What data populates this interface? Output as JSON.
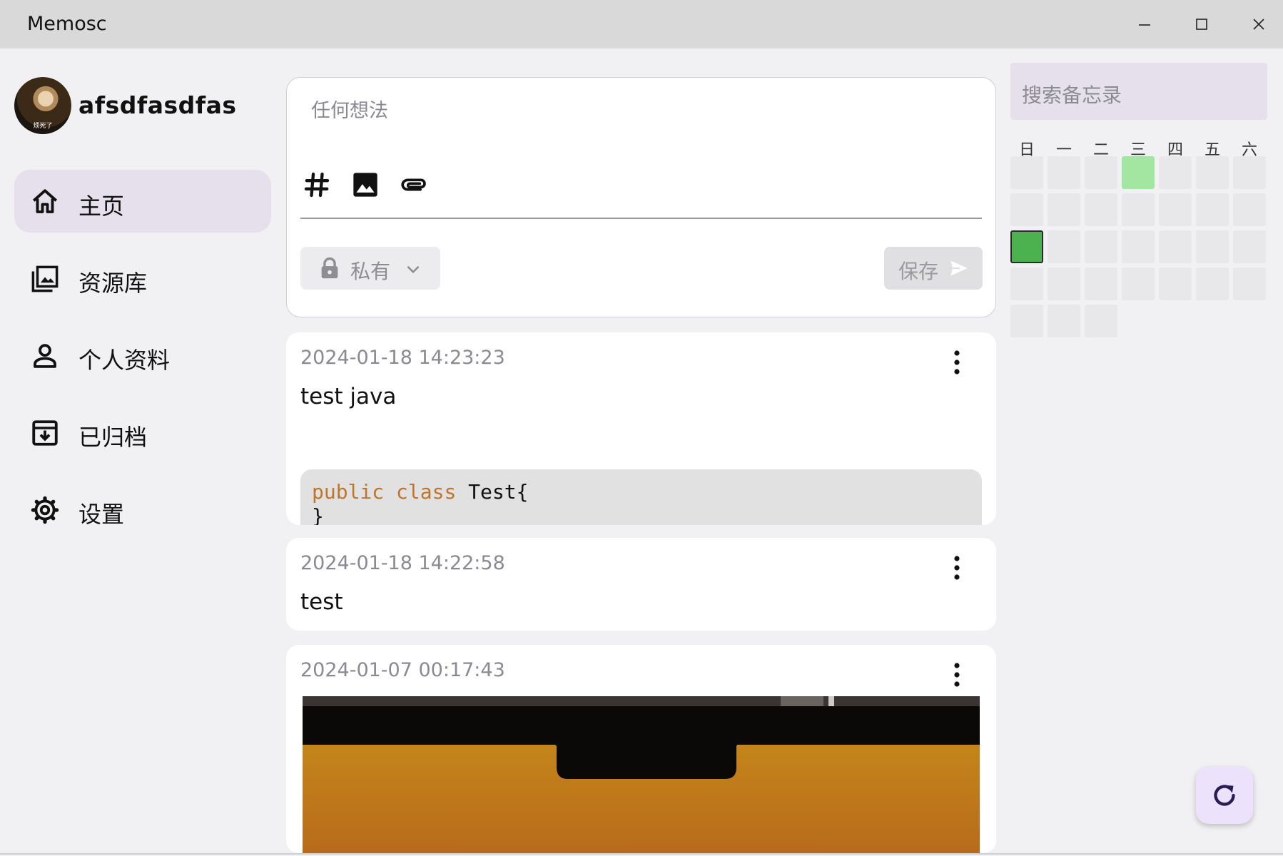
{
  "window": {
    "title": "Memosc",
    "controls": [
      "minimize-icon",
      "maximize-icon",
      "close-icon"
    ]
  },
  "sidebar": {
    "username": "afsdfasdfas",
    "avatar_caption": "烦死了",
    "items": [
      {
        "label": "主页",
        "icon": "home-icon",
        "active": true
      },
      {
        "label": "资源库",
        "icon": "gallery-icon",
        "active": false
      },
      {
        "label": "个人资料",
        "icon": "person-icon",
        "active": false
      },
      {
        "label": "已归档",
        "icon": "archive-icon",
        "active": false
      },
      {
        "label": "设置",
        "icon": "gear-icon",
        "active": false
      }
    ]
  },
  "editor": {
    "placeholder": "任何想法",
    "tools": [
      "hashtag-icon",
      "image-icon",
      "attachment-icon"
    ],
    "visibility_label": "私有",
    "save_label": "保存"
  },
  "memos": [
    {
      "time": "2024-01-18 14:23:23",
      "text": "test java",
      "code": {
        "keyword1": "public",
        "keyword2": "class",
        "rest": "Test{",
        "line2": "}"
      }
    },
    {
      "time": "2024-01-18 14:22:58",
      "text": "test"
    },
    {
      "time": "2024-01-07 00:17:43",
      "image": "photo-of-laptop-screen"
    }
  ],
  "search": {
    "placeholder": "搜索备忘录"
  },
  "calendar": {
    "weekdays": [
      "日",
      "一",
      "二",
      "三",
      "四",
      "五",
      "六"
    ],
    "cells": [
      [
        0,
        0,
        0,
        1,
        0,
        0,
        0
      ],
      [
        0,
        0,
        0,
        0,
        0,
        0,
        0
      ],
      [
        2,
        0,
        0,
        0,
        0,
        0,
        0
      ],
      [
        0,
        0,
        0,
        0,
        0,
        0,
        0
      ],
      [
        0,
        0,
        0
      ]
    ]
  },
  "colors": {
    "accent": "#e5e0ec",
    "cal_empty": "#e8e8ea",
    "cal_light": "#a2e6a2",
    "cal_strong": "#4cb24f",
    "code_keyword": "#c0762a"
  },
  "refresh": {
    "icon": "refresh-icon"
  }
}
